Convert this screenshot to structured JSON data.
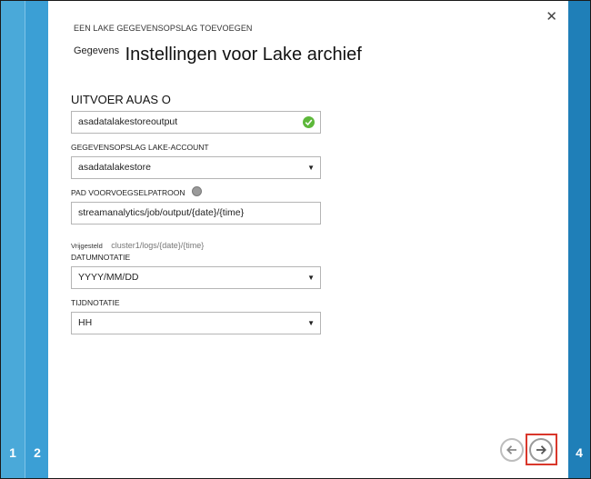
{
  "steps": {
    "step1": "1",
    "step2": "2",
    "step4": "4"
  },
  "dialog": {
    "title": "EEN LAKE GEGEVENSOPSLAG TOEVOEGEN",
    "subtitle_small": "Gegevens",
    "subtitle_big": "Instellingen voor Lake archief",
    "close_icon": "close-icon"
  },
  "form": {
    "section_label": "UITVOER AUAS O",
    "output_alias": {
      "value": "asadatalakestoreoutput",
      "status_icon": "check-circle-icon",
      "status_color": "#5db83a"
    },
    "account": {
      "label": "GEGEVENSOPSLAG LAKE-ACCOUNT",
      "value": "asadatalakestore"
    },
    "path_prefix": {
      "label": "PAD VOORVOEGSELPATROON",
      "value": "streamanalytics/job/output/{date}/{time}",
      "info_icon": "info-icon"
    },
    "example": {
      "label": "Vrijgesteld",
      "value": "cluster1/logs/{date}/{time}"
    },
    "date_format": {
      "label": "DATUMNOTATIE",
      "value": "YYYY/MM/DD"
    },
    "time_format": {
      "label": "TIJDNOTATIE",
      "value": "HH"
    }
  },
  "navigation": {
    "prev_icon": "arrow-left-icon",
    "next_icon": "arrow-right-icon",
    "highlight_color": "#d9372b"
  },
  "colors": {
    "step1": "#4aa9d9",
    "step2": "#3b9fd5",
    "step4": "#1f7fb8"
  }
}
